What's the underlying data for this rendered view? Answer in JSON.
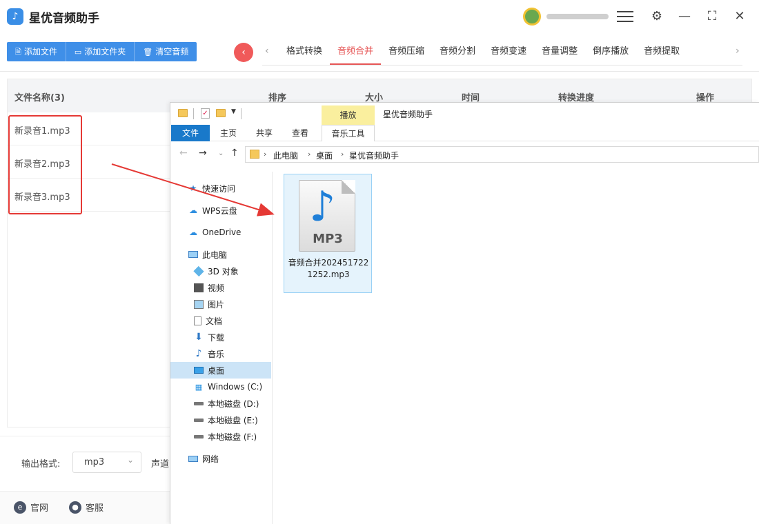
{
  "app": {
    "title": "星优音频助手",
    "logo_glyph": "♪",
    "accent": "#3f8fe8",
    "active_tab_color": "#e65555"
  },
  "toolbar": {
    "add_file": "添加文件",
    "add_folder": "添加文件夹",
    "clear_audio": "清空音频"
  },
  "tabs": [
    "格式转换",
    "音频合并",
    "音频压缩",
    "音频分割",
    "音频变速",
    "音量调整",
    "倒序播放",
    "音频提取"
  ],
  "active_tab": "音频合并",
  "table": {
    "headers": {
      "name": "文件名称(3)",
      "order": "排序",
      "size": "大小",
      "time": "时间",
      "progress": "转换进度",
      "action": "操作"
    },
    "rows": [
      "新录音1.mp3",
      "新录音2.mp3",
      "新录音3.mp3"
    ]
  },
  "output": {
    "format_label": "输出格式:",
    "format_value": "mp3",
    "channel_label": "声道"
  },
  "footer": {
    "website": "官网",
    "service": "客服"
  },
  "explorer": {
    "window_title": "星优音频助手",
    "play_tab": "播放",
    "ribbon": {
      "file": "文件",
      "home": "主页",
      "share": "共享",
      "view": "查看",
      "music_tools": "音乐工具"
    },
    "breadcrumb": [
      "此电脑",
      "桌面",
      "星优音频助手"
    ],
    "nav": [
      {
        "label": "快速访问",
        "icon": "star-icon"
      },
      {
        "label": "WPS云盘",
        "icon": "cloud-icon"
      },
      {
        "label": "OneDrive",
        "icon": "cloud-icon"
      },
      {
        "label": "此电脑",
        "icon": "computer-icon"
      },
      {
        "label": "3D 对象",
        "icon": "cube-icon"
      },
      {
        "label": "视频",
        "icon": "video-icon"
      },
      {
        "label": "图片",
        "icon": "picture-icon"
      },
      {
        "label": "文档",
        "icon": "document-icon"
      },
      {
        "label": "下载",
        "icon": "download-icon"
      },
      {
        "label": "音乐",
        "icon": "music-icon"
      },
      {
        "label": "桌面",
        "icon": "desktop-icon"
      },
      {
        "label": "Windows (C:)",
        "icon": "windows-drive-icon"
      },
      {
        "label": "本地磁盘 (D:)",
        "icon": "drive-icon"
      },
      {
        "label": "本地磁盘 (E:)",
        "icon": "drive-icon"
      },
      {
        "label": "本地磁盘 (F:)",
        "icon": "drive-icon"
      },
      {
        "label": "网络",
        "icon": "network-icon"
      }
    ],
    "selected_nav": "桌面",
    "file": {
      "icon_text": "MP3",
      "name": "音频合并2024517221252.mp3"
    }
  }
}
